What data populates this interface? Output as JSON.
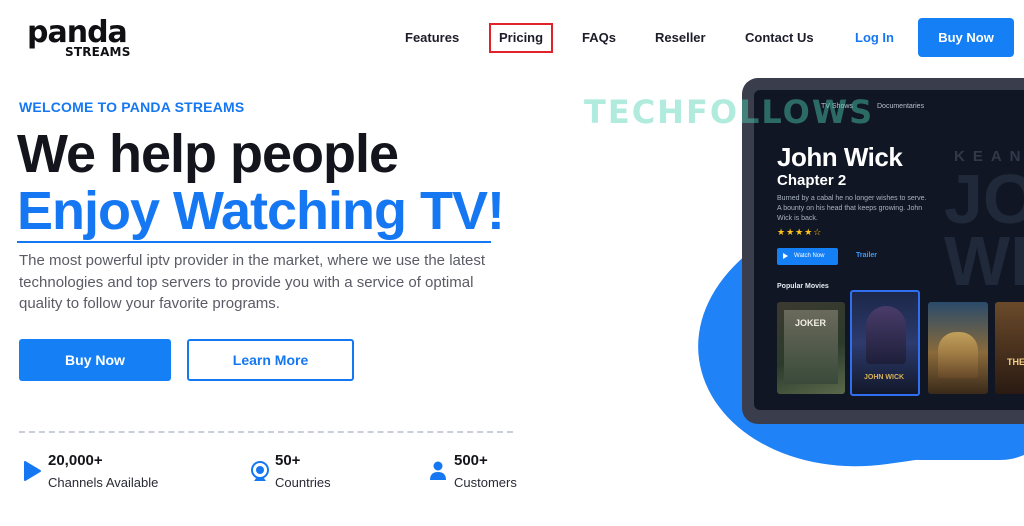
{
  "logo": {
    "line1": "panda",
    "line2": "STREAMS"
  },
  "nav": {
    "items": [
      "Features",
      "Pricing",
      "FAQs",
      "Reseller",
      "Contact Us"
    ],
    "login": "Log In",
    "buy_now": "Buy Now"
  },
  "hero": {
    "eyebrow": "WELCOME TO PANDA STREAMS",
    "title_line1": "We help people",
    "title_line2": "Enjoy Watching TV!",
    "description": "The most powerful iptv provider in the market, where we use the latest technologies and top servers to provide you with a service of optimal quality to follow your favorite programs.",
    "buy_now": "Buy Now",
    "learn_more": "Learn More"
  },
  "stats": [
    {
      "value": "20,000+",
      "label": "Channels Available",
      "icon": "play-icon"
    },
    {
      "value": "50+",
      "label": "Countries",
      "icon": "webcam-icon"
    },
    {
      "value": "500+",
      "label": "Customers",
      "icon": "user-icon"
    }
  ],
  "watermark": "TECHFOLLOWS",
  "mockup": {
    "tabs": [
      "TV Shows",
      "Documentaries"
    ],
    "bg_text_1": "JOHN",
    "bg_text_2": "WICK",
    "bg_keanu": "KEANU",
    "title": "John Wick",
    "subtitle": "Chapter 2",
    "description": "Burned by a cabal he no longer wishes to serve. A bounty on his head that keeps growing. John Wick is back.",
    "stars": "★★★★☆",
    "watch_now": "Watch Now",
    "trailer": "Trailer",
    "popular": "Popular Movies",
    "posters": [
      "JOKER",
      "JOHN WICK",
      "",
      "THE"
    ]
  },
  "colors": {
    "accent": "#1677f2",
    "active_border": "#e0222a"
  }
}
